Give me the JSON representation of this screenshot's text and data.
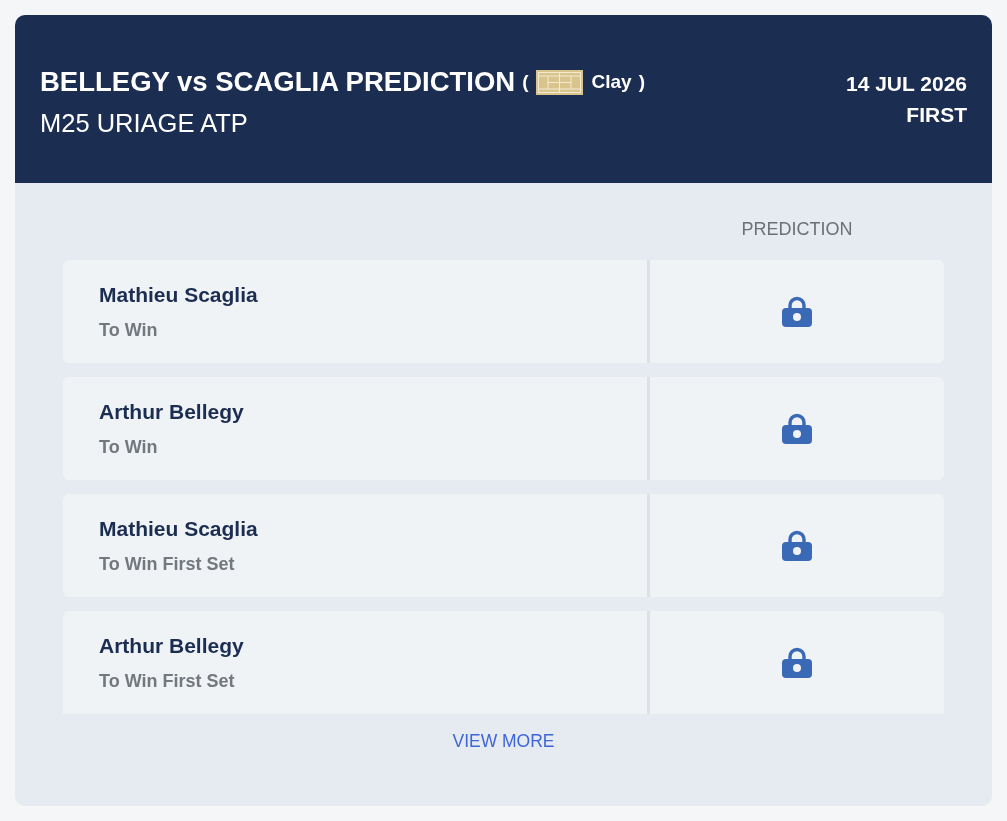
{
  "header": {
    "title": "BELLEGY vs SCAGLIA PREDICTION",
    "surface_open": "(",
    "surface": {
      "label": "Clay",
      "kind": "clay"
    },
    "surface_close": ")",
    "subtitle": "M25 URIAGE ATP",
    "date": "14 JUL 2026",
    "round": "FIRST"
  },
  "table": {
    "columns": [
      "PREDICTION"
    ],
    "rows": [
      {
        "player": "Mathieu Scaglia",
        "market": "To Win",
        "locked": true
      },
      {
        "player": "Arthur Bellegy",
        "market": "To Win",
        "locked": true
      },
      {
        "player": "Mathieu Scaglia",
        "market": "To Win First Set",
        "locked": true
      },
      {
        "player": "Arthur Bellegy",
        "market": "To Win First Set",
        "locked": true
      }
    ]
  },
  "view_more": "VIEW MORE"
}
